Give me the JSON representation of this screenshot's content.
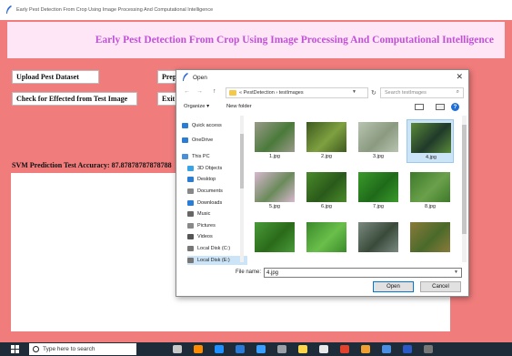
{
  "app": {
    "window_title": "Early Pest Detection From Crop Using Image Processing And Computational Intelligence",
    "header_title": "Early Pest Detection From Crop Using Image Processing And Computational Intelligence",
    "buttons": {
      "upload": "Upload Pest Dataset",
      "preprocess_partial": "Prep",
      "check": "Check for Effected from Test Image",
      "exit_partial": "Exit"
    },
    "accuracy_text": "SVM Prediction Test Accuracy: 87.87878787878788",
    "colors": {
      "background": "#f07c7c",
      "header_bg": "#ffe6f7",
      "header_text": "#c050d8"
    }
  },
  "dialog": {
    "title": "Open",
    "close": "✕",
    "nav": {
      "back": "←",
      "forward": "→",
      "up": "↑"
    },
    "breadcrumb": "« PestDetection › testImages",
    "search_placeholder": "Search testImages",
    "commands": {
      "organize": "Organize ▾",
      "new_folder": "New folder"
    },
    "help": "?",
    "nav_items": [
      {
        "label": "Quick access",
        "icon": "star-icon",
        "color": "#2b7cd3"
      },
      {
        "label": "OneDrive",
        "icon": "cloud-icon",
        "color": "#2b7cd3"
      },
      {
        "label": "This PC",
        "icon": "computer-icon",
        "color": "#4a90d9"
      },
      {
        "label": "3D Objects",
        "icon": "cube-icon",
        "color": "#3aa3e3"
      },
      {
        "label": "Desktop",
        "icon": "desktop-icon",
        "color": "#2b7cd3"
      },
      {
        "label": "Documents",
        "icon": "document-icon",
        "color": "#888888"
      },
      {
        "label": "Downloads",
        "icon": "download-icon",
        "color": "#2b7cd3"
      },
      {
        "label": "Music",
        "icon": "music-icon",
        "color": "#666666"
      },
      {
        "label": "Pictures",
        "icon": "picture-icon",
        "color": "#888888"
      },
      {
        "label": "Videos",
        "icon": "video-icon",
        "color": "#555555"
      },
      {
        "label": "Local Disk (C:)",
        "icon": "disk-icon",
        "color": "#777777"
      },
      {
        "label": "Local Disk (E:)",
        "icon": "disk-icon",
        "color": "#777777"
      }
    ],
    "files": [
      {
        "name": "1.jpg",
        "colors": [
          "#9a9a8a",
          "#4a7a3a"
        ]
      },
      {
        "name": "2.jpg",
        "colors": [
          "#3e5a1f",
          "#7fa040"
        ]
      },
      {
        "name": "3.jpg",
        "colors": [
          "#b8c4b0",
          "#8a9a80"
        ]
      },
      {
        "name": "4.jpg",
        "colors": [
          "#5a8a3a",
          "#203a2a"
        ]
      },
      {
        "name": "5.jpg",
        "colors": [
          "#d8b8d0",
          "#6a8a5a"
        ]
      },
      {
        "name": "6.jpg",
        "colors": [
          "#4a8a2a",
          "#2a5a1a"
        ]
      },
      {
        "name": "7.jpg",
        "colors": [
          "#3a9a2a",
          "#1f6a1a"
        ]
      },
      {
        "name": "8.jpg",
        "colors": [
          "#3e7a2a",
          "#6aa04a"
        ]
      },
      {
        "name": "",
        "colors": [
          "#4a9a3a",
          "#2a6a1a"
        ]
      },
      {
        "name": "",
        "colors": [
          "#3a8a2a",
          "#6abf4a"
        ]
      },
      {
        "name": "",
        "colors": [
          "#7a8a80",
          "#3a4a3a"
        ]
      },
      {
        "name": "",
        "colors": [
          "#8a7a3a",
          "#4a6a2a"
        ]
      }
    ],
    "filename_label": "File name:",
    "filename_value": "4.jpg",
    "open_label": "Open",
    "cancel_label": "Cancel"
  },
  "taskbar": {
    "search_placeholder": "Type here to search",
    "apps": [
      "#c8c8c8",
      "#ff8c00",
      "#1e90ff",
      "#2a7ad8",
      "#3aa0ff",
      "#9aa0a6",
      "#ffd54a",
      "#e8e8e8",
      "#e2412b",
      "#f0a030",
      "#4a90e2",
      "#2a5ac8",
      "#777777"
    ]
  }
}
